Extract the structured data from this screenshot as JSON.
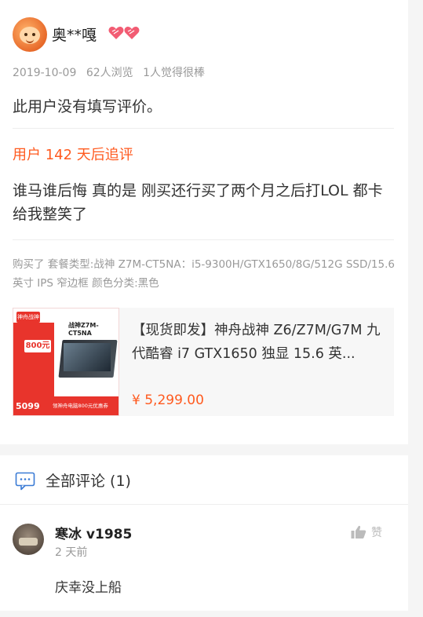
{
  "review": {
    "username": "奥**嘎",
    "date": "2019-10-09",
    "views": "62人浏览",
    "likes": "1人觉得很棒",
    "text": "此用户没有填写评价。"
  },
  "followup": {
    "title": "用户 142 天后追评",
    "text": "谁马谁后悔 真的是  刚买还行买了两个月之后打LOL 都卡  给我整笑了"
  },
  "purchase_info": "购买了 套餐类型:战神 Z7M-CT5NA：i5-9300H/GTX1650/8G/512G SSD/15.6 英寸 IPS 窄边框 颜色分类:黑色",
  "product": {
    "title": "【现货即发】神舟战神 Z6/Z7M/G7M 九代酷睿 i7 GTX1650 独显 15.6 英...",
    "price": "¥ 5,299.00",
    "thumb": {
      "logo_text": "神舟战神",
      "model": "战神Z7M-CT5NA",
      "coupon": "800元",
      "bottom_price": "5099",
      "bottom_text": "领神舟电脑800元优惠券"
    }
  },
  "comments": {
    "title": "全部评论 (1)",
    "items": [
      {
        "name": "寒冰 v1985",
        "time": "2 天前",
        "text": "庆幸没上船",
        "like_label": "赞"
      }
    ]
  },
  "colors": {
    "accent": "#ff5a1f",
    "brand_red": "#e8342c",
    "muted_text": "#999999",
    "icon_blue": "#3a7bd5"
  }
}
